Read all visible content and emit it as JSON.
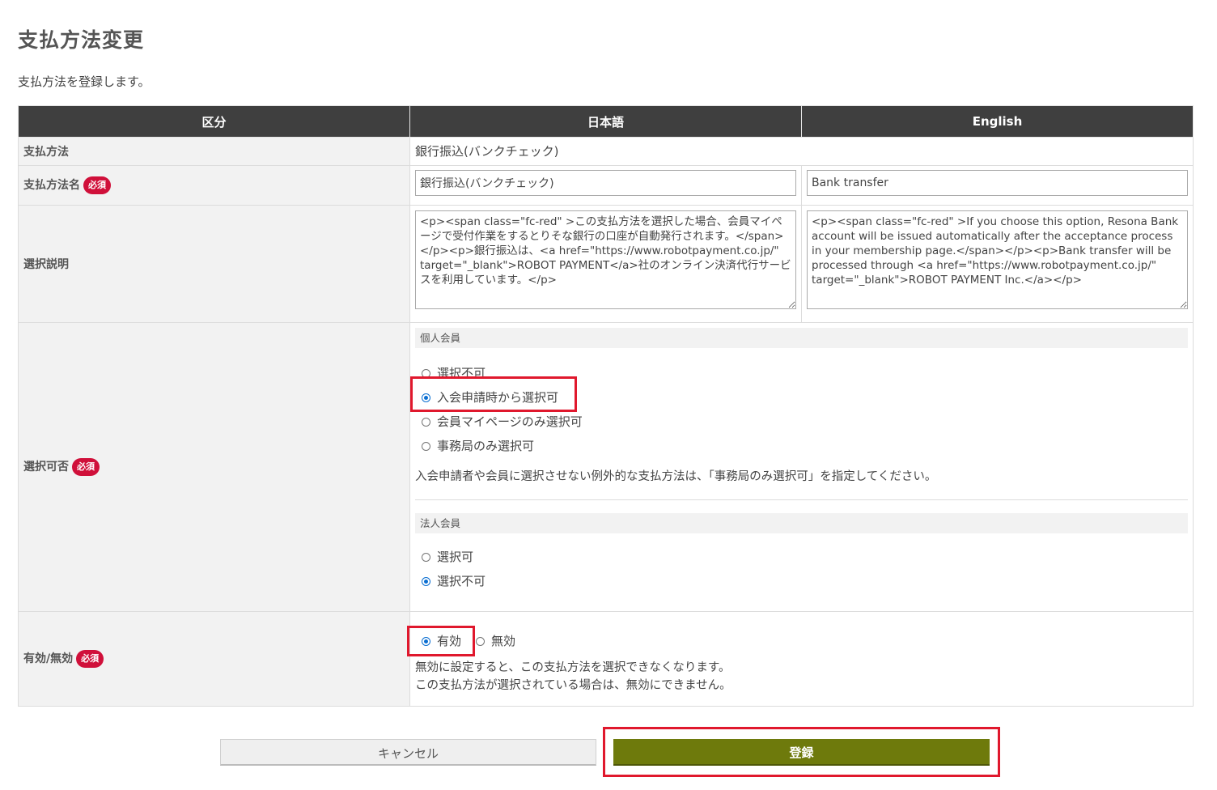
{
  "page": {
    "title": "支払方法変更",
    "description": "支払方法を登録します。"
  },
  "table": {
    "headers": [
      "区分",
      "日本語",
      "English"
    ],
    "rows": {
      "payment_method": {
        "label": "支払方法",
        "value": "銀行振込(バンクチェック)"
      },
      "payment_method_name": {
        "label": "支払方法名",
        "required": "必須",
        "value_ja": "銀行振込(バンクチェック)",
        "value_en": "Bank transfer"
      },
      "selection_description": {
        "label": "選択説明",
        "value_ja": "<p><span class=\"fc-red\" >この支払方法を選択した場合、会員マイページで受付作業をするとりそな銀行の口座が自動発行されます。</span></p><p>銀行振込は、<a href=\"https://www.robotpayment.co.jp/\" target=\"_blank\">ROBOT PAYMENT</a>社のオンライン決済代行サービスを利用しています。</p>",
        "value_en": "<p><span class=\"fc-red\" >If you choose this option, Resona Bank account will be issued automatically after the acceptance process in your membership page.</span></p><p>Bank transfer will be processed through <a href=\"https://www.robotpayment.co.jp/\" target=\"_blank\">ROBOT PAYMENT Inc.</a></p>"
      },
      "selectability": {
        "label": "選択可否",
        "required": "必須",
        "individual": {
          "heading": "個人会員",
          "options": [
            {
              "label": "選択不可",
              "checked": false
            },
            {
              "label": "入会申請時から選択可",
              "checked": true
            },
            {
              "label": "会員マイページのみ選択可",
              "checked": false
            },
            {
              "label": "事務局のみ選択可",
              "checked": false
            }
          ],
          "note": "入会申請者や会員に選択させない例外的な支払方法は、「事務局のみ選択可」を指定してください。"
        },
        "corporate": {
          "heading": "法人会員",
          "options": [
            {
              "label": "選択可",
              "checked": false
            },
            {
              "label": "選択不可",
              "checked": true
            }
          ]
        }
      },
      "enabled": {
        "label": "有効/無効",
        "required": "必須",
        "options": [
          {
            "label": "有効",
            "checked": true
          },
          {
            "label": "無効",
            "checked": false
          }
        ],
        "note_line1": "無効に設定すると、この支払方法を選択できなくなります。",
        "note_line2": "この支払方法が選択されている場合は、無効にできません。"
      }
    }
  },
  "buttons": {
    "cancel": "キャンセル",
    "submit": "登録"
  },
  "colors": {
    "header_bg": "#3f3f3f",
    "required_badge": "#d0103a",
    "submit_button": "#6e7a0c",
    "highlight_box": "#e0182d",
    "radio_checked": "#0a6ed1"
  }
}
